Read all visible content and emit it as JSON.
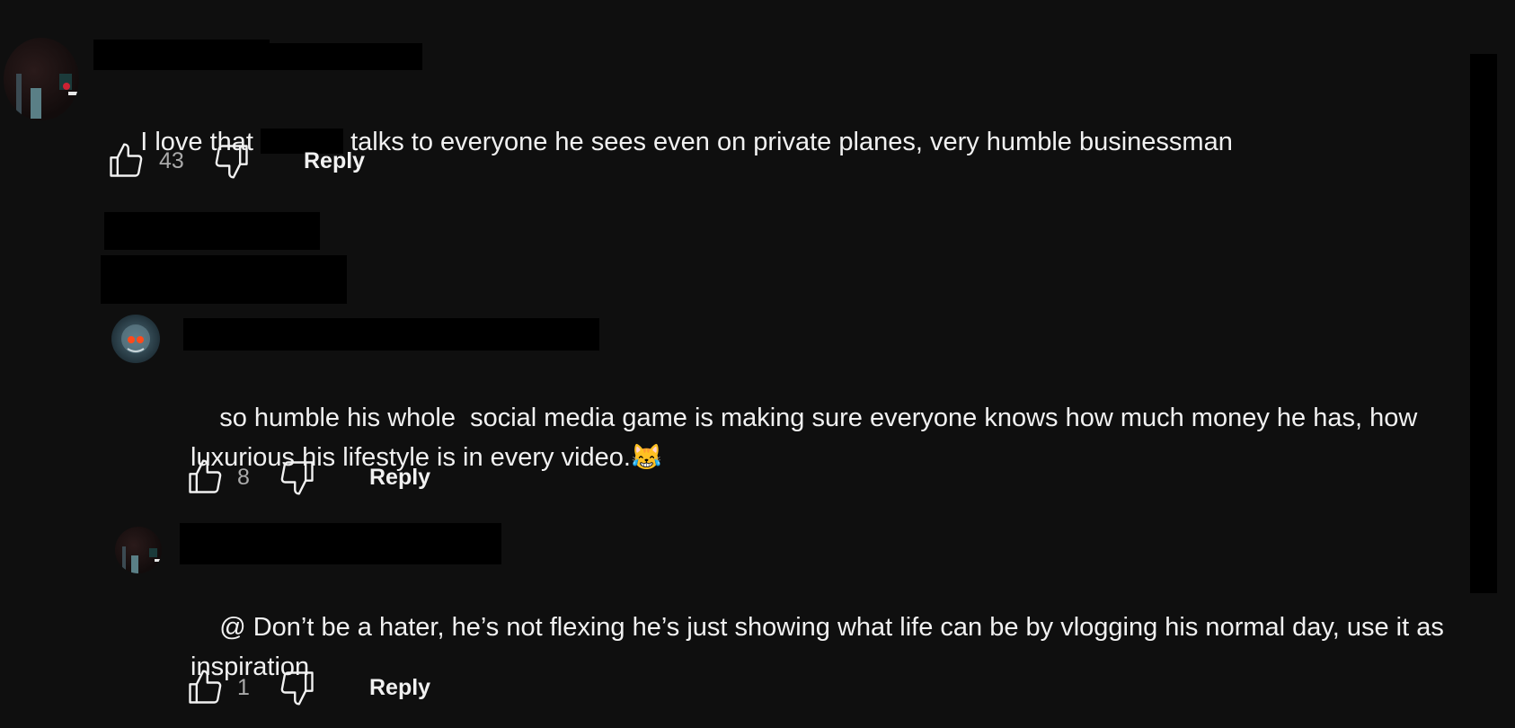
{
  "colors": {
    "background": "#0f0f0f",
    "text": "#f1f1f1",
    "muted": "#aaaaaa",
    "redaction": "#000000"
  },
  "comments": [
    {
      "text_before": "I love that ",
      "text_after": " talks to everyone he sees even on private planes, very humble businessman",
      "likes": "43",
      "reply_label": "Reply"
    }
  ],
  "replies": [
    {
      "text": "so humble his whole  social media game is making sure everyone knows how much money he has, how luxurious his lifestyle is in every video.",
      "emoji": "😹",
      "likes": "8",
      "reply_label": "Reply"
    },
    {
      "text": "@ Don’t be a hater, he’s not flexing he’s just showing what life can be by vlogging his normal day, use it as inspiration",
      "likes": "1",
      "reply_label": "Reply"
    }
  ],
  "icons": {
    "like": "thumbs-up-icon",
    "dislike": "thumbs-down-icon"
  }
}
